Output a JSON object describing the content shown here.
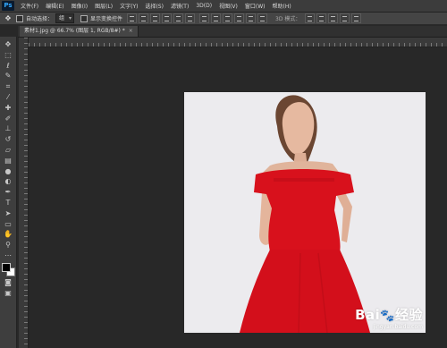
{
  "app": {
    "logo": "Ps"
  },
  "menu": [
    "文件(F)",
    "编辑(E)",
    "图像(I)",
    "图层(L)",
    "文字(Y)",
    "选择(S)",
    "滤镜(T)",
    "3D(D)",
    "视图(V)",
    "窗口(W)",
    "帮助(H)"
  ],
  "options": {
    "tool_icon": "move-icon",
    "auto_select_label": "自动选择：",
    "auto_select_value": "组",
    "show_transform_label": "显示变换控件",
    "mode_3d_label": "3D 模式："
  },
  "document": {
    "tab_title": "素材1.jpg @ 66.7% (图层 1, RGB/8#) *",
    "close_glyph": "×"
  },
  "tools": [
    "move-icon",
    "marquee-icon",
    "lasso-icon",
    "quick-select-icon",
    "crop-icon",
    "eyedropper-icon",
    "healing-icon",
    "brush-icon",
    "clone-stamp-icon",
    "history-brush-icon",
    "eraser-icon",
    "gradient-icon",
    "blur-icon",
    "dodge-icon",
    "pen-icon",
    "type-icon",
    "path-select-icon",
    "shape-icon",
    "hand-icon",
    "zoom-icon"
  ],
  "colors": {
    "foreground": "#000000",
    "background": "#ffffff",
    "dress": "#d8111c",
    "photo_bg": "#ecebee"
  },
  "watermark": {
    "logo": "Bai",
    "logo_paw": "🐾",
    "logo_cn": "经验",
    "url": "jingyan.baidu.com"
  }
}
